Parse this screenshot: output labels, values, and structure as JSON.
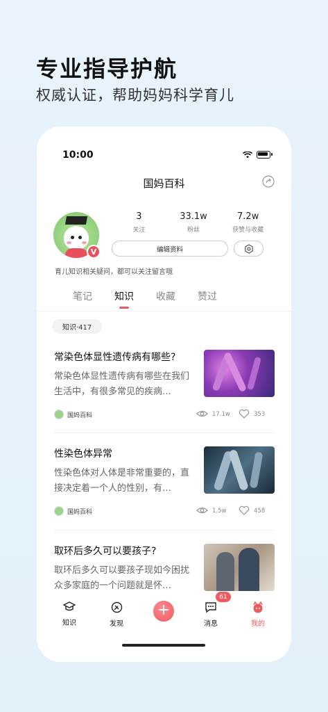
{
  "promo": {
    "title": "专业指导护航",
    "subtitle": "权威认证，帮助妈妈科学育儿"
  },
  "status_bar": {
    "time": "10:00"
  },
  "header": {
    "title": "国妈百科",
    "share_icon": "share-icon"
  },
  "profile": {
    "verified_badge": "V",
    "stats": [
      {
        "value": "3",
        "label": "关注"
      },
      {
        "value": "33.1w",
        "label": "粉丝"
      },
      {
        "value": "7.2w",
        "label": "获赞与收藏"
      }
    ],
    "edit_label": "编辑资料",
    "bio": "育儿知识相关疑问，都可以关注留言哦"
  },
  "tabs": [
    "笔记",
    "知识",
    "收藏",
    "赞过"
  ],
  "active_tab": "知识",
  "chip": "知识·417",
  "articles": [
    {
      "title": "常染色体显性遗传病有哪些?",
      "excerpt": "常染色体显性遗传病有哪些在我们生活中，有很多常见的疾病…",
      "author": "国妈百科",
      "views": "17.1w",
      "likes": "353"
    },
    {
      "title": "性染色体异常",
      "excerpt": "性染色体对人体是非常重要的，直接决定着一个人的性别，有…",
      "author": "国妈百科",
      "views": "1.5w",
      "likes": "458"
    },
    {
      "title": "取环后多久可以要孩子?",
      "excerpt": "取环后多久可以要孩子现如今困扰众多家庭的一个问题就是怀…",
      "author": "",
      "views": "",
      "likes": ""
    }
  ],
  "tabbar": {
    "items": [
      "知识",
      "发现",
      "",
      "消息",
      "我的"
    ],
    "plus": "+",
    "message_badge": "61"
  },
  "colors": {
    "accent": "#ef5a5f"
  }
}
